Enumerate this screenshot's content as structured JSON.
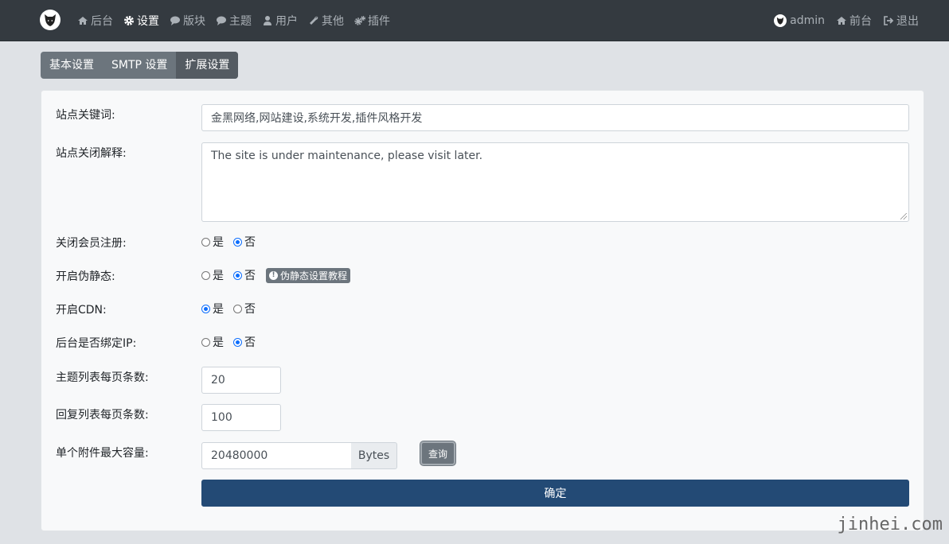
{
  "nav": {
    "left": [
      {
        "label": "后台",
        "icon": "home-icon"
      },
      {
        "label": "设置",
        "icon": "gear-icon"
      },
      {
        "label": "版块",
        "icon": "comment-icon"
      },
      {
        "label": "主题",
        "icon": "comment-icon"
      },
      {
        "label": "用户",
        "icon": "user-icon"
      },
      {
        "label": "其他",
        "icon": "wrench-icon"
      },
      {
        "label": "插件",
        "icon": "cogs-icon"
      }
    ],
    "right": [
      {
        "label": "admin",
        "icon": "avatar-icon"
      },
      {
        "label": "前台",
        "icon": "home-icon"
      },
      {
        "label": "退出",
        "icon": "logout-icon"
      }
    ],
    "active": "设置"
  },
  "tabs": [
    "基本设置",
    "SMTP 设置",
    "扩展设置"
  ],
  "active_tab": "扩展设置",
  "form": {
    "keywords": {
      "label": "站点关键词:",
      "value": "金黑网络,网站建设,系统开发,插件风格开发"
    },
    "close_reason": {
      "label": "站点关闭解释:",
      "value": "The site is under maintenance, please visit later."
    },
    "close_register": {
      "label": "关闭会员注册:",
      "yes": "是",
      "no": "否",
      "selected": "否"
    },
    "rewrite": {
      "label": "开启伪静态:",
      "yes": "是",
      "no": "否",
      "selected": "否",
      "badge": "伪静态设置教程"
    },
    "cdn": {
      "label": "开启CDN:",
      "yes": "是",
      "no": "否",
      "selected": "是"
    },
    "bind_ip": {
      "label": "后台是否绑定IP:",
      "yes": "是",
      "no": "否",
      "selected": "否"
    },
    "thread_pagesize": {
      "label": "主题列表每页条数:",
      "value": "20"
    },
    "post_pagesize": {
      "label": "回复列表每页条数:",
      "value": "100"
    },
    "attach_max": {
      "label": "单个附件最大容量:",
      "value": "20480000",
      "unit": "Bytes",
      "query": "查询"
    },
    "submit": "确定"
  },
  "watermark": "jinhei.com"
}
